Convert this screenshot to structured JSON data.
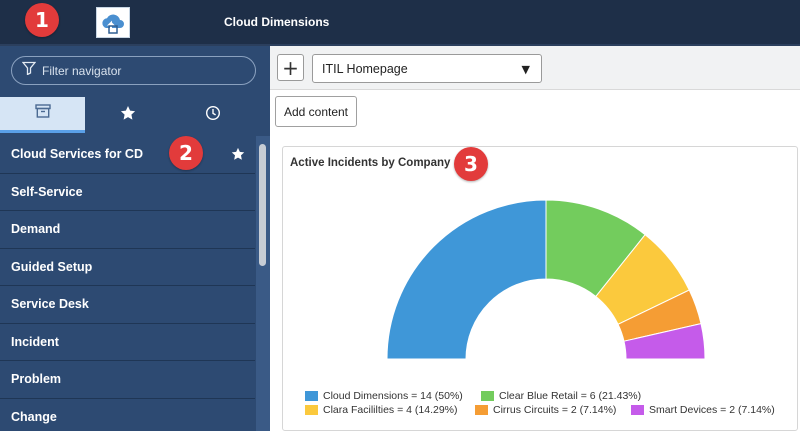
{
  "header": {
    "app_title": "Cloud Dimensions",
    "callout_1": "1"
  },
  "sidebar": {
    "filter_placeholder": "Filter navigator",
    "tabs": [
      {
        "icon": "archive-icon",
        "active": true
      },
      {
        "icon": "star-icon",
        "active": false
      },
      {
        "icon": "clock-icon",
        "active": false
      }
    ],
    "callout_2": "2",
    "items": [
      {
        "label": "Cloud Services for CD",
        "starred": true
      },
      {
        "label": "Self-Service"
      },
      {
        "label": "Demand"
      },
      {
        "label": "Guided Setup"
      },
      {
        "label": "Service Desk"
      },
      {
        "label": "Incident"
      },
      {
        "label": "Problem"
      },
      {
        "label": "Change"
      }
    ]
  },
  "toolbar": {
    "add_symbol": "+",
    "dashboard_selected": "ITIL Homepage",
    "caret": "▼",
    "add_content_label": "Add content"
  },
  "widget": {
    "title": "Active Incidents by Company",
    "callout_3": "3"
  },
  "colors": {
    "header_bg": "#1e2f48",
    "sidebar_bg": "#2d4a72",
    "callout": "#e23b3b"
  },
  "chart_data": {
    "type": "pie",
    "variant": "semi-donut",
    "title": "Active Incidents by Company",
    "slices": [
      {
        "name": "Cloud Dimensions",
        "value": 14,
        "percent": 50,
        "color": "#3f97d8",
        "legend": "Cloud Dimensions = 14 (50%)"
      },
      {
        "name": "Clear Blue Retail",
        "value": 6,
        "percent": 21.43,
        "color": "#73cc5d",
        "legend": "Clear Blue Retail = 6 (21.43%)"
      },
      {
        "name": "Clara Facililties",
        "value": 4,
        "percent": 14.29,
        "color": "#fbc93d",
        "legend": "Clara Facililties = 4 (14.29%)"
      },
      {
        "name": "Cirrus Circuits",
        "value": 2,
        "percent": 7.14,
        "color": "#f59d34",
        "legend": "Cirrus Circuits = 2 (7.14%)"
      },
      {
        "name": "Smart Devices",
        "value": 2,
        "percent": 7.14,
        "color": "#c55bea",
        "legend": "Smart Devices = 2 (7.14%)"
      }
    ],
    "legend_placement": "bottom"
  }
}
